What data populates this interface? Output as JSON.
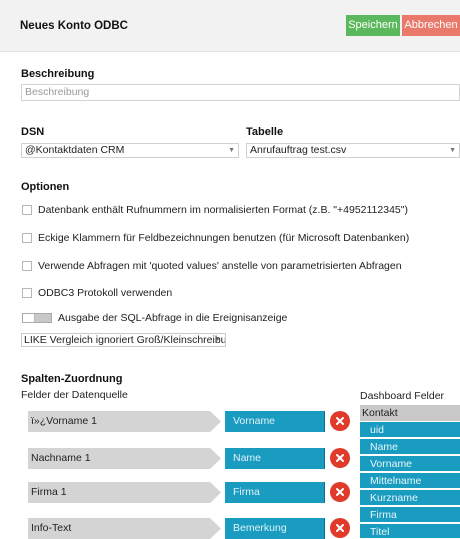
{
  "header": {
    "title": "Neues Konto ODBC",
    "save_label": "Speichern",
    "cancel_label": "Abbrechen"
  },
  "description": {
    "label": "Beschreibung",
    "placeholder": "Beschreibung"
  },
  "dsn": {
    "label": "DSN",
    "value": "@Kontaktdaten CRM"
  },
  "table": {
    "label": "Tabelle",
    "value": "Anrufauftrag test.csv"
  },
  "options": {
    "label": "Optionen",
    "items": [
      "Datenbank enthält Rufnummern im normalisierten Format (z.B. \"+4952112345\")",
      "Eckige Klammern für Feldbezeichnungen benutzen (für Microsoft Datenbanken)",
      "Verwende Abfragen mit 'quoted values' anstelle von parametrisierten Abfragen",
      "ODBC3 Protokoll verwenden"
    ],
    "toggle_label": "Ausgabe der SQL-Abfrage in die Ereignisanzeige",
    "like_select": "LIKE Vergleich ignoriert Groß/Kleinschreibung"
  },
  "mapping": {
    "label": "Spalten-Zuordnung",
    "source_label": "Felder der Datenquelle",
    "dashboard_label": "Dashboard Felder",
    "rows": [
      {
        "source": "ï»¿Vorname 1",
        "target": "Vorname"
      },
      {
        "source": "Nachname 1",
        "target": "Name"
      },
      {
        "source": "Firma 1",
        "target": "Firma"
      },
      {
        "source": "Info-Text",
        "target": "Bemerkung"
      }
    ],
    "dashboard_group": "Kontakt",
    "dashboard_fields": [
      "uid",
      "Name",
      "Vorname",
      "Mittelname",
      "Kurzname",
      "Firma",
      "Titel"
    ]
  },
  "icons": {
    "remove": "close-circle-icon",
    "dropdown": "chevron-down-icon"
  },
  "colors": {
    "save": "#5cb85c",
    "cancel": "#e9796a",
    "field_blue": "#1a9cc0",
    "remove_red": "#e03a2a"
  }
}
